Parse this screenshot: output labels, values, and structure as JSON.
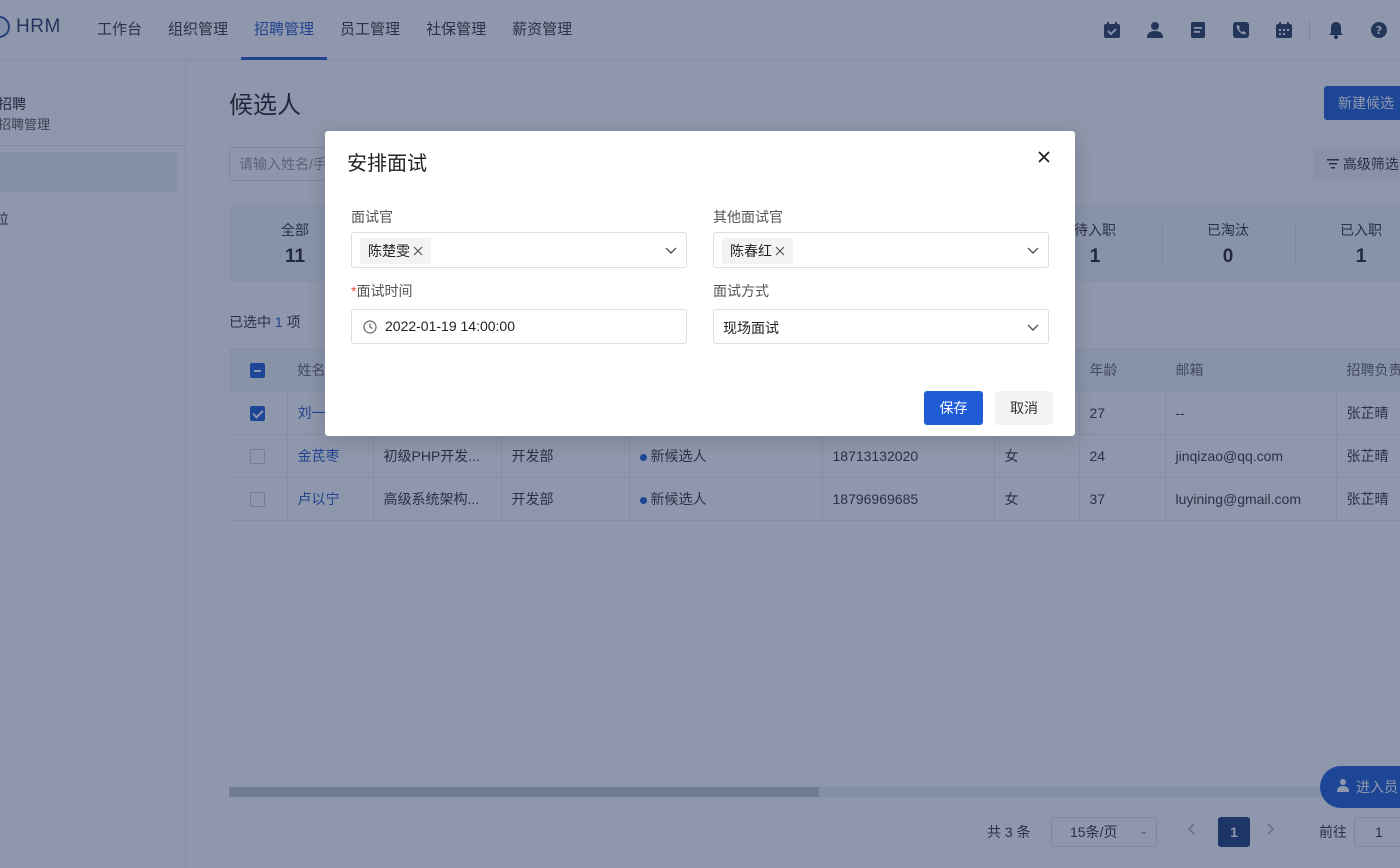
{
  "header": {
    "logo_text": "HRM",
    "nav": [
      {
        "label": "工作台",
        "active": false
      },
      {
        "label": "组织管理",
        "active": false
      },
      {
        "label": "招聘管理",
        "active": true
      },
      {
        "label": "员工管理",
        "active": false
      },
      {
        "label": "社保管理",
        "active": false
      },
      {
        "label": "薪资管理",
        "active": false
      }
    ],
    "tool_icons": [
      "calendar-check-icon",
      "person-icon",
      "document-icon",
      "phone-icon",
      "calendar-icon",
      "bell-icon",
      "help-icon"
    ]
  },
  "sidebar": {
    "title": "招聘",
    "subtitle": "招聘管理",
    "item2": "位"
  },
  "main": {
    "title": "候选人",
    "new_button": "新建候选",
    "search_placeholder": "请输入姓名/手",
    "advanced_filter": "高级筛选",
    "stats": [
      {
        "label": "全部",
        "value": "11"
      },
      {
        "label": "待入职",
        "value": "1"
      },
      {
        "label": "已淘汰",
        "value": "0"
      },
      {
        "label": "已入职",
        "value": "1"
      }
    ],
    "selected_prefix": "已选中",
    "selected_count": "1",
    "selected_suffix": "项"
  },
  "table": {
    "columns": [
      "姓名",
      "年龄",
      "邮箱",
      "招聘负责"
    ],
    "rows": [
      {
        "checked": true,
        "name": "刘一",
        "position": "",
        "dept": "",
        "status": "",
        "phone": "",
        "gender": "",
        "age": "27",
        "email": "--",
        "owner": "张芷晴"
      },
      {
        "checked": false,
        "name": "金芪枣",
        "position": "初级PHP开发...",
        "dept": "开发部",
        "status": "新候选人",
        "phone": "18713132020",
        "gender": "女",
        "age": "24",
        "email": "jinqizao@qq.com",
        "owner": "张芷晴"
      },
      {
        "checked": false,
        "name": "卢以宁",
        "position": "高级系统架构...",
        "dept": "开发部",
        "status": "新候选人",
        "phone": "18796969685",
        "gender": "女",
        "age": "37",
        "email": "luyining@gmail.com",
        "owner": "张芷晴"
      }
    ]
  },
  "float_button": "进入员",
  "pagination": {
    "total": "共 3 条",
    "page_size": "15条/页",
    "current": "1",
    "goto_label": "前往",
    "goto_value": "1"
  },
  "modal": {
    "title": "安排面试",
    "interviewer_label": "面试官",
    "interviewer_tag": "陈楚雯",
    "other_label": "其他面试官",
    "other_tag": "陈春红",
    "time_label": "面试时间",
    "time_required": "*",
    "time_value": "2022-01-19 14:00:00",
    "mode_label": "面试方式",
    "mode_value": "现场面试",
    "save": "保存",
    "cancel": "取消"
  },
  "colors": {
    "primary": "#1f5cd6",
    "overlay": "#1e3058",
    "required": "#f04c3b"
  }
}
